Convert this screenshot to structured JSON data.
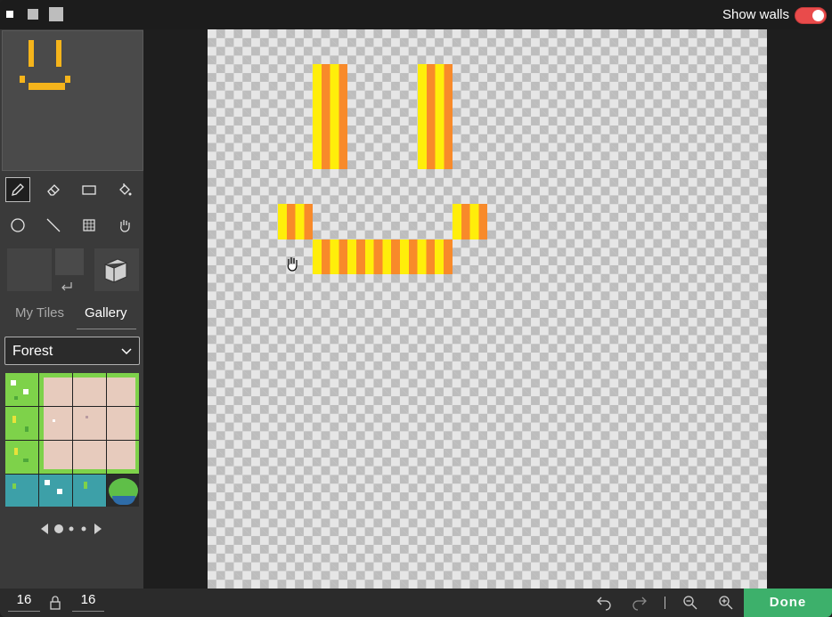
{
  "topbar": {
    "show_walls_label": "Show walls",
    "show_walls_on": true,
    "size_buttons": [
      "small",
      "medium",
      "large"
    ]
  },
  "sidebar": {
    "tools": [
      "pencil-icon",
      "eraser-icon",
      "rectangle-icon",
      "fill-bucket-icon",
      "circle-icon",
      "line-icon",
      "select-grid-icon",
      "hand-icon"
    ],
    "active_tool": "pencil-icon",
    "tabs": [
      {
        "label": "My Tiles",
        "active": false
      },
      {
        "label": "Gallery",
        "active": true
      }
    ],
    "tileset_select": {
      "value": "Forest"
    },
    "pager": {
      "pages": 3,
      "current": 1
    }
  },
  "colors": {
    "stripe_yellow": "#ffee0a",
    "stripe_orange": "#f88a2a",
    "preview_pixel": "#f5b41b",
    "done_green": "#3db06b"
  },
  "bottombar": {
    "width_value": "16",
    "height_value": "16",
    "done_label": "Done"
  }
}
